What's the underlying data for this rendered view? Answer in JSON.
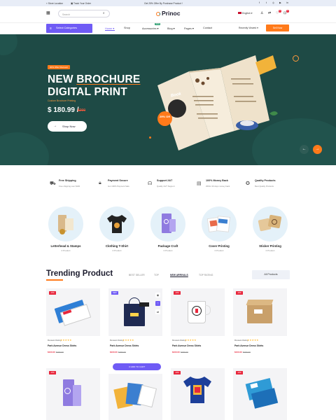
{
  "topbar": {
    "store_location": "Store Location",
    "track_order": "Track Your Order",
    "promo": "Get 25% Offer By Purchase Product !",
    "social": [
      "f",
      "t",
      "◎",
      "▶",
      "in"
    ]
  },
  "header": {
    "logo": "Prinoc",
    "search_placeholder": "Search",
    "language": "English",
    "wishlist_count": "0",
    "cart_count": "0"
  },
  "nav": {
    "categories_button": "Select Categories",
    "items": [
      "Home",
      "Shop",
      "Accessories",
      "Blog",
      "Pages",
      "Contact"
    ],
    "new_tag": "NEW",
    "recently_viewed": "Recently Viewed",
    "sell_button": "Sell Now"
  },
  "hero": {
    "offer_tag": "30% Offer Discount",
    "title_line1_prefix": "NEW ",
    "title_line1_brand": "BROCHURE",
    "title_line2": "DIGITAL PRINT",
    "subtitle": "Custom Brochure Printing",
    "price": "$ 180.99 /",
    "old_price": "$200",
    "shop_button": "Shop Now",
    "discount_badge": "29% Off",
    "brochure_word": "Book"
  },
  "features": [
    {
      "icon": "truck",
      "title": "Free Shipping",
      "sub": "Free shipping over $100"
    },
    {
      "icon": "lock",
      "title": "Payment Secure",
      "sub": "Got 100% Payment Safe"
    },
    {
      "icon": "headset",
      "title": "Support 24/7",
      "sub": "Quality 24/7 Support"
    },
    {
      "icon": "money",
      "title": "100% Money Back",
      "sub": "Within 30 days money back"
    },
    {
      "icon": "badge",
      "title": "Quality Products",
      "sub": "Best Quality Products"
    }
  ],
  "categories": [
    {
      "name": "Letterhead & Stamps",
      "count": "0 Product"
    },
    {
      "name": "Clothing T-Shirt",
      "count": "0 Product"
    },
    {
      "name": "Package Craft",
      "count": "0 Product"
    },
    {
      "name": "Cover Printing",
      "count": "0 Product"
    },
    {
      "name": "Sticker Printing",
      "count": "0 Product"
    }
  ],
  "trending": {
    "title": "Trending Product",
    "tabs": [
      "BEST SELLER",
      "TOP",
      "NEW ARRIVALS",
      "TOP RATING"
    ],
    "all_products": "All Products",
    "add_to_cart": "ADD TO CART",
    "products": [
      {
        "badge": "-10%",
        "reviews": "Reviews Rating",
        "name": "Park Avenue Dress Shirts",
        "price": "$100.00",
        "old": "$150.00"
      },
      {
        "badge": "NEW",
        "reviews": "Reviews Rating",
        "name": "Park Avenue Dress Shirts",
        "price": "$100.00",
        "old": "$150.00"
      },
      {
        "badge": "-10%",
        "reviews": "Reviews Rating",
        "name": "Park Avenue Dress Shirts",
        "price": "$100.00",
        "old": "$150.00"
      },
      {
        "badge": "-10%",
        "reviews": "Reviews Rating",
        "name": "Park Avenue Dress Shirts",
        "price": "$100.00",
        "old": "$150.00"
      },
      {
        "badge": "-10%"
      },
      {
        "badge": ""
      },
      {
        "badge": "-10%"
      },
      {
        "badge": "-10%"
      }
    ]
  },
  "colors": {
    "hero_bg": "#1e4a45",
    "accent": "#ff7a1a",
    "primary": "#6f5bf5",
    "sale": "#e8273c"
  }
}
